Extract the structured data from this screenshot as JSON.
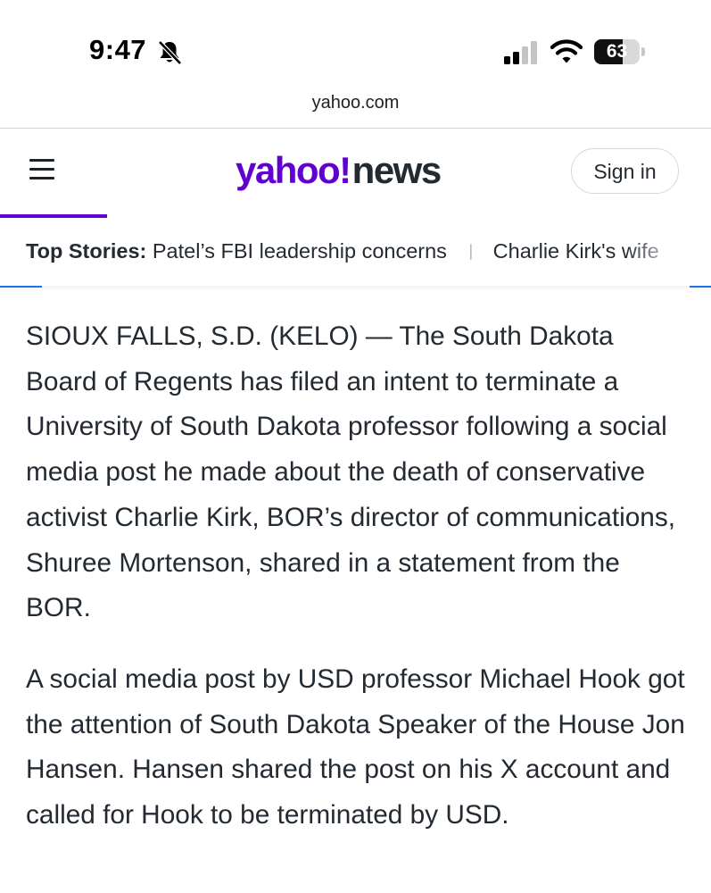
{
  "status_bar": {
    "time": "9:47",
    "battery_percent": "63",
    "battery_level": 0.63,
    "icons": [
      "bell-slash-icon",
      "cellular-signal-icon",
      "wifi-icon",
      "battery-icon"
    ]
  },
  "browser": {
    "url": "yahoo.com"
  },
  "header": {
    "logo_yahoo": "yahoo!",
    "logo_news": "news",
    "sign_in_label": "Sign in",
    "menu_icon": "hamburger-menu-icon",
    "accent_color": "#6001d2"
  },
  "top_stories": {
    "label": "Top Stories:",
    "items": [
      "Patel’s FBI leadership concerns",
      "Charlie Kirk's wife"
    ]
  },
  "article": {
    "paragraphs": [
      "SIOUX FALLS, S.D. (KELO) — The South Dakota Board of Regents has filed an intent to terminate a University of South Dakota professor following a social media post he made about the death of conservative activist Charlie Kirk, BOR’s director of communications, Shuree Mortenson, shared in a statement from the BOR.",
      "A social media post by USD professor Michael Hook got the attention of South Dakota Speaker of the House Jon Hansen. Hansen shared the post on his X account and called for Hook to be terminated by USD."
    ]
  }
}
